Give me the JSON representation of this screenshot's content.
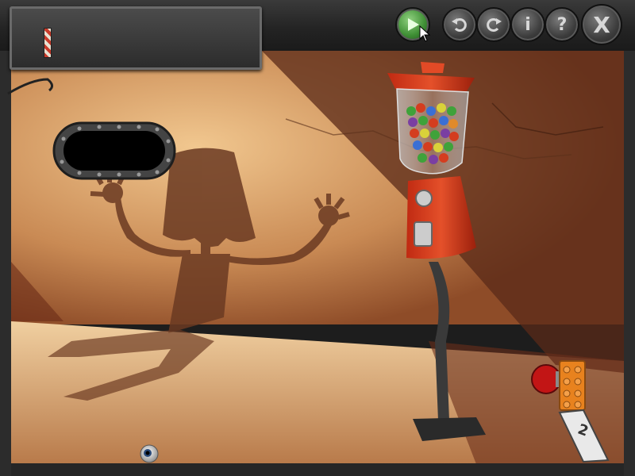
{
  "toolbar": {
    "play": "play",
    "undo": "undo",
    "redo": "redo",
    "info": "i",
    "help": "?",
    "close": "X"
  },
  "colors": {
    "wall": "#c98a54",
    "floor": "#e0b07c",
    "gumball_machine": "#d43d1f",
    "play_button": "#3f8f35"
  },
  "scene": {
    "counter_label": "2"
  }
}
